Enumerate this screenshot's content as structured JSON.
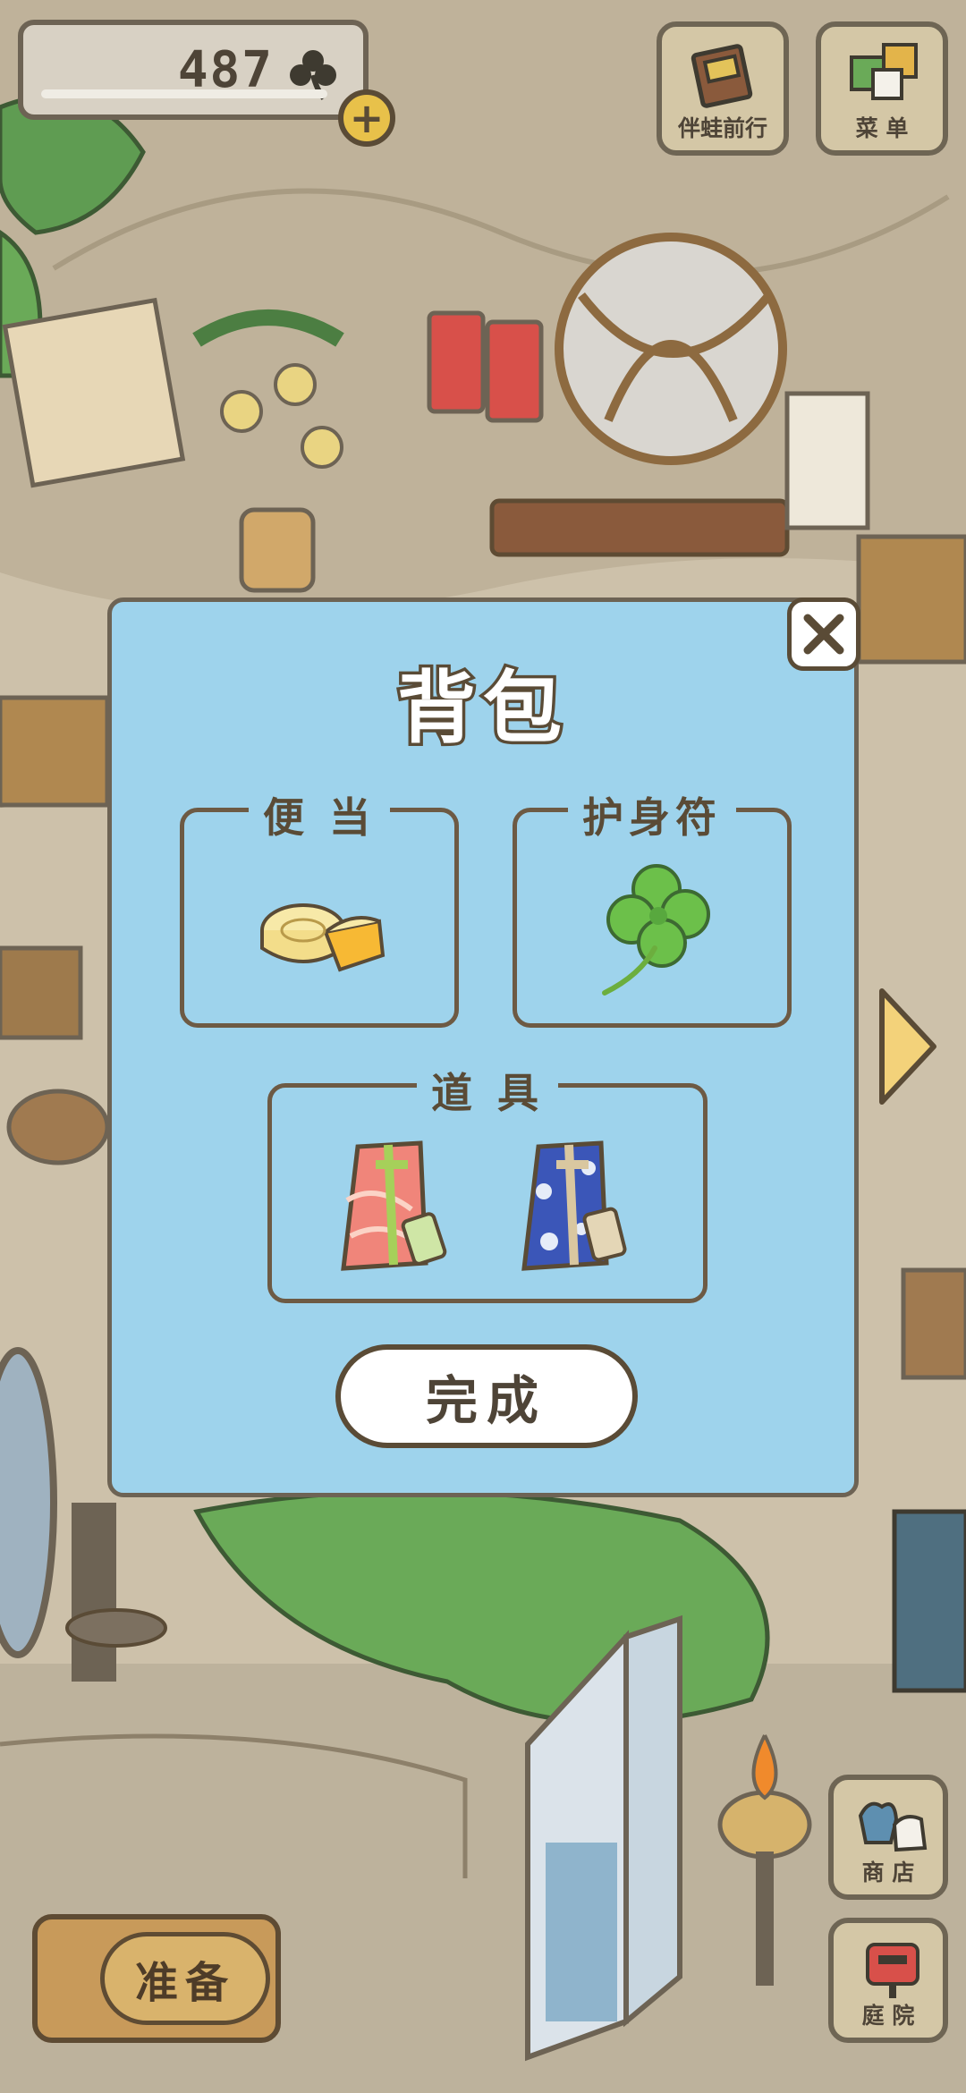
{
  "header": {
    "clover_count": "487",
    "plus_label": "+",
    "travel_button_label": "伴蛙前行",
    "menu_button_label": "菜 单"
  },
  "side_buttons": {
    "shop_label": "商 店",
    "yard_label": "庭 院"
  },
  "bottom": {
    "prepare_label": "准备"
  },
  "dialog": {
    "title": "背包",
    "slots": [
      {
        "label": "便 当",
        "item_icon": "mooncake-icon"
      },
      {
        "label": "护身符",
        "item_icon": "four-leaf-clover-icon"
      },
      {
        "label": "道 具",
        "item_icons": [
          "red-wrapped-bundle-icon",
          "blue-wrapped-bundle-icon"
        ]
      }
    ],
    "done_label": "完成",
    "close_icon": "close-icon"
  },
  "colors": {
    "dialog_bg": "#9ed3ec",
    "outline": "#5a4b36",
    "clover_green": "#6cc04a"
  }
}
